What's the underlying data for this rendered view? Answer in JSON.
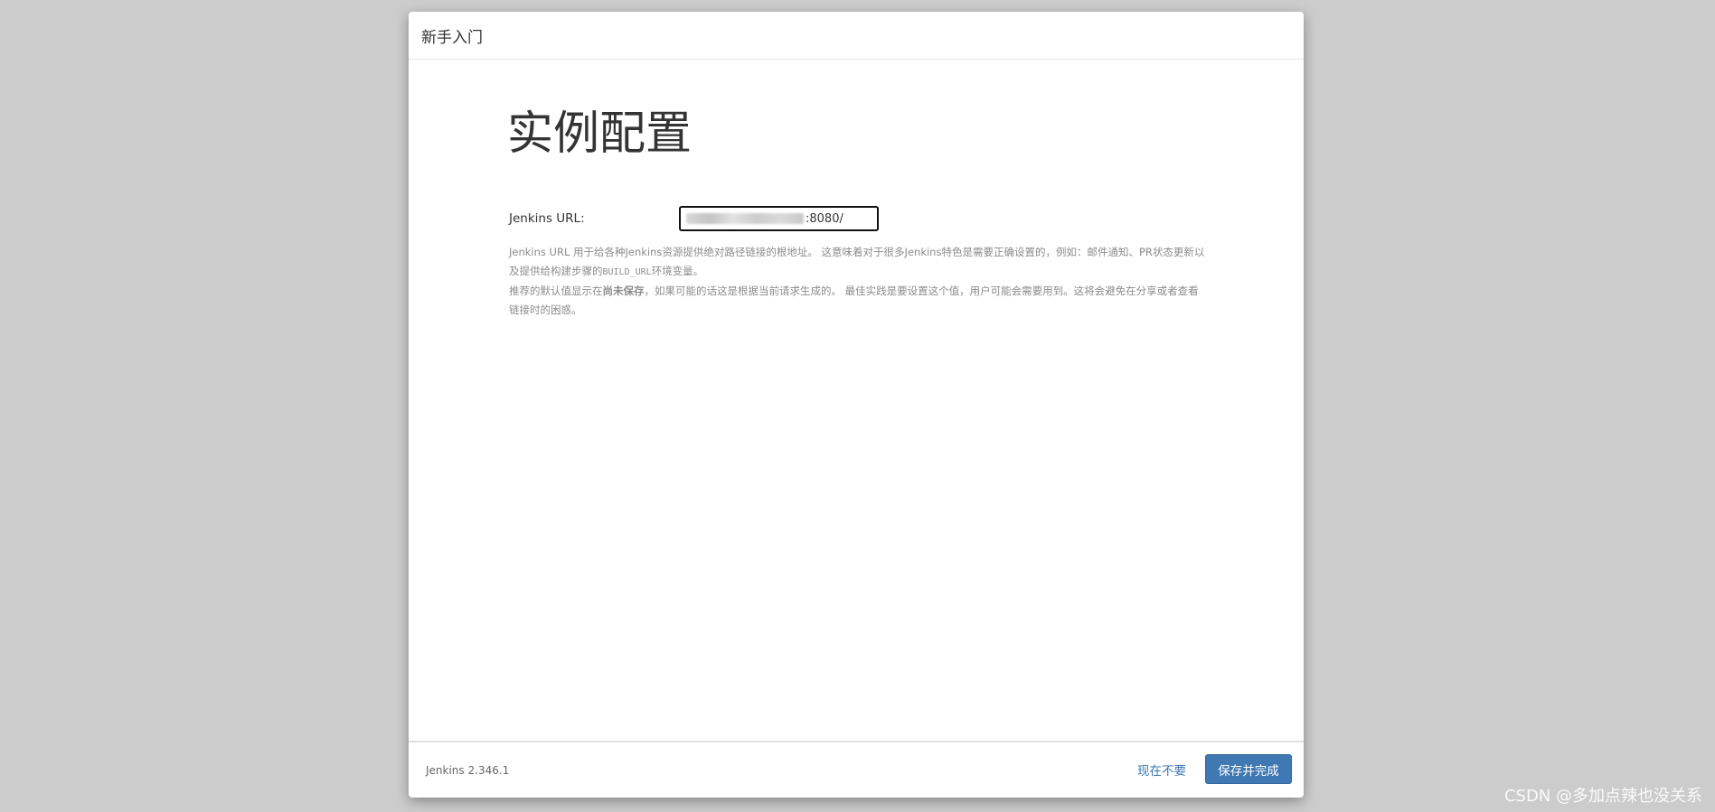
{
  "dialog": {
    "title": "新手入门"
  },
  "page": {
    "heading": "实例配置"
  },
  "url_field": {
    "label": "Jenkins URL:",
    "value": ":8080/"
  },
  "help": {
    "line1_a": "Jenkins URL 用于给各种Jenkins资源提供绝对路径链接的根地址。 这意味着对于很多Jenkins特色是需要正确设置的，例如：邮件通知、PR状态更新以及提供给构建步骤的",
    "line1_code": "BUILD_URL",
    "line1_b": "环境变量。",
    "line2_a": "推荐的默认值显示在",
    "line2_bold": "尚未保存",
    "line2_b": "，如果可能的话这是根据当前请求生成的。 最佳实践是要设置这个值，用户可能会需要用到。这将会避免在分享或者查看链接时的困惑。"
  },
  "footer": {
    "version": "Jenkins 2.346.1",
    "skip_label": "现在不要",
    "save_label": "保存并完成"
  },
  "watermark": "CSDN @多加点辣也没关系"
}
